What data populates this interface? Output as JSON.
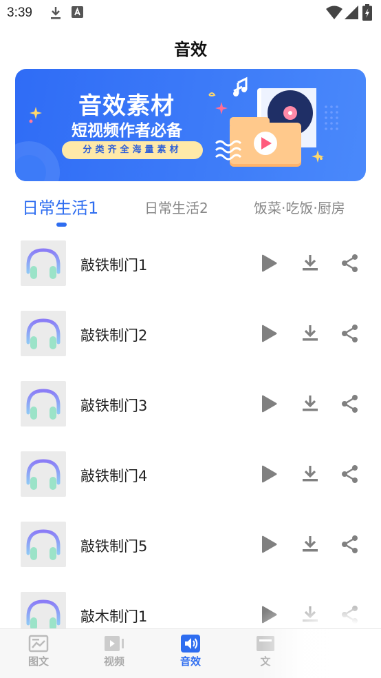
{
  "status_bar": {
    "time": "3:39"
  },
  "header": {
    "title": "音效"
  },
  "banner": {
    "title": "音效素材",
    "subtitle": "短视频作者必备",
    "tagline": "分类齐全海量素材"
  },
  "tabs": [
    {
      "label": "日常生活1",
      "active": true
    },
    {
      "label": "日常生活2",
      "active": false
    },
    {
      "label": "饭菜·吃饭·厨房",
      "active": false
    }
  ],
  "sounds": [
    {
      "title": "敲铁制门1"
    },
    {
      "title": "敲铁制门2"
    },
    {
      "title": "敲铁制门3"
    },
    {
      "title": "敲铁制门4"
    },
    {
      "title": "敲铁制门5"
    },
    {
      "title": "敲木制门1"
    }
  ],
  "bottom_nav": [
    {
      "label": "图文",
      "icon": "image-text-icon",
      "active": false
    },
    {
      "label": "视频",
      "icon": "video-icon",
      "active": false
    },
    {
      "label": "音效",
      "icon": "speaker-icon",
      "active": true
    },
    {
      "label": "文",
      "icon": "text-icon",
      "active": false
    }
  ],
  "colors": {
    "accent": "#2e6df0",
    "banner": "#3d7bf8",
    "icon_gray": "#888888"
  }
}
